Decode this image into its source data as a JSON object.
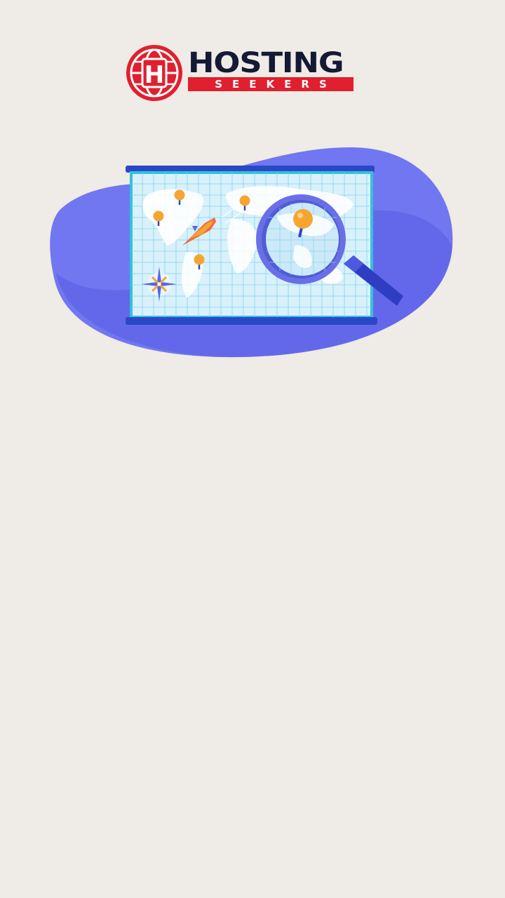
{
  "brand": {
    "name_top": "HOSTING",
    "name_bottom": "SEEKERS",
    "mark_letter": "H",
    "colors": {
      "red": "#e0202e",
      "navy": "#141a33",
      "background": "#efebe6",
      "blob": "#7177f0",
      "map": "#d9f1fb",
      "pin": "#f6a531"
    }
  },
  "illustration": {
    "subject": "world-map-with-magnifying-glass",
    "icons": [
      "globe-icon",
      "map-pin-icon",
      "rocket-icon",
      "compass-icon",
      "magnifying-glass-icon"
    ]
  }
}
